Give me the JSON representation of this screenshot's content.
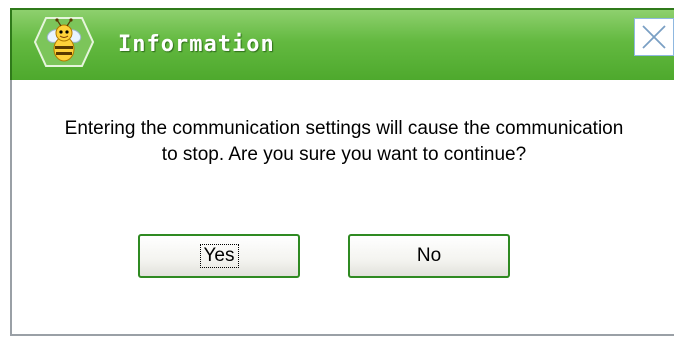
{
  "window": {
    "title": "Information",
    "app_icon": "bee-logo-icon",
    "close_icon": "close-icon"
  },
  "message": {
    "line1": "Entering the communication settings will cause the communication",
    "line2": "to stop. Are you sure you want to continue?"
  },
  "buttons": {
    "yes_label": "Yes",
    "no_label": "No",
    "focused": "Yes"
  },
  "colors": {
    "titlebar": "#63b940",
    "button_border": "#2f8a22",
    "close_button_border": "#8fb8e0"
  }
}
